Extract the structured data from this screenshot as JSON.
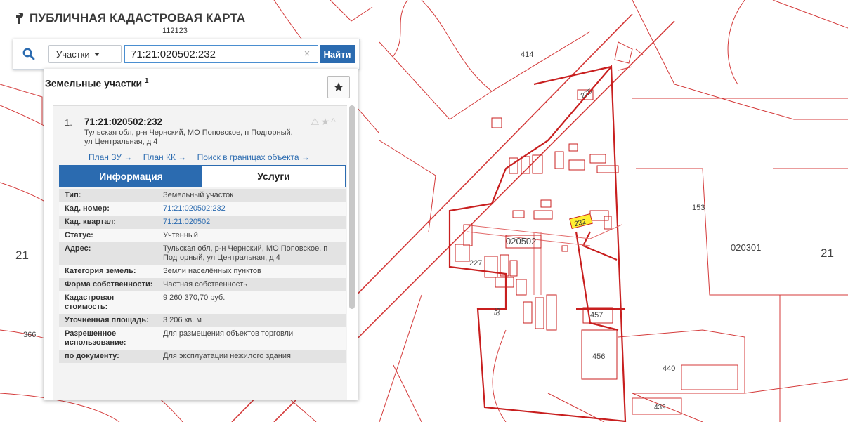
{
  "header": {
    "title": "ПУБЛИЧНАЯ КАДАСТРОВАЯ КАРТА",
    "sublabel": "112123"
  },
  "search": {
    "type_label": "Участки",
    "query": "71:21:020502:232",
    "clear_glyph": "×",
    "find_label": "Найти"
  },
  "panel": {
    "title": "Земельные участки",
    "count": "1",
    "result": {
      "number": "1.",
      "cad_number": "71:21:020502:232",
      "address": "Тульская обл, р-н Чернский, МО Поповское, п Подгорный, ул Центральная, д 4",
      "links": [
        "План ЗУ →",
        "План КК →",
        "Поиск в границах объекта →"
      ]
    },
    "tabs": [
      {
        "label": "Информация",
        "active": true
      },
      {
        "label": "Услуги",
        "active": false
      }
    ],
    "rows": [
      {
        "key": "Тип:",
        "value": "Земельный участок",
        "link": false
      },
      {
        "key": "Кад. номер:",
        "value": "71:21:020502:232",
        "link": true
      },
      {
        "key": "Кад. квартал:",
        "value": "71:21:020502",
        "link": true
      },
      {
        "key": "Статус:",
        "value": "Учтенный",
        "link": false
      },
      {
        "key": "Адрес:",
        "value": "Тульская обл, р-н Чернский, МО Поповское, п Подгорный, ул Центральная, д 4",
        "link": false
      },
      {
        "key": "Категория земель:",
        "value": "Земли населённых пунктов",
        "link": false
      },
      {
        "key": "Форма собственности:",
        "value": "Частная собственность",
        "link": false
      },
      {
        "key": "Кадастровая стоимость:",
        "value": "9 260 370,70 руб.",
        "link": false
      },
      {
        "key": "Уточненная площадь:",
        "value": "3 206 кв. м",
        "link": false
      },
      {
        "key": "Разрешенное использование:",
        "value": "Для размещения объектов торговли",
        "link": false
      },
      {
        "key": "по документу:",
        "value": "Для эксплуатации нежилого здания",
        "link": false
      }
    ]
  },
  "map": {
    "labels": {
      "p414": "414",
      "p225": "225",
      "p153": "153",
      "p232": "232",
      "q020502": "020502",
      "q020301": "020301",
      "p227": "227",
      "p21_left": "21",
      "p21_right": "21",
      "p366": "366",
      "p457": "457",
      "p456": "456",
      "p440": "440",
      "p439": "439",
      "p55": "55"
    },
    "colors": {
      "boundary": "#cc1f1f",
      "highlight": "#ffee33"
    }
  }
}
